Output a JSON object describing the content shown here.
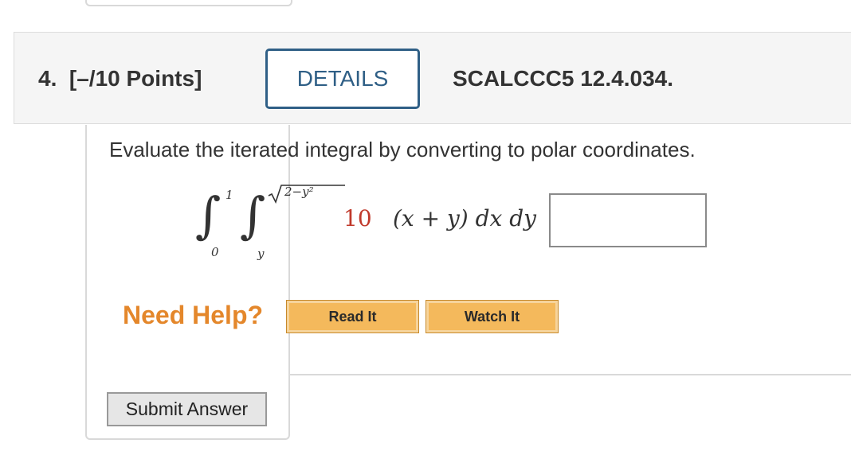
{
  "question": {
    "label": "4.  [–/10 Points]",
    "details_label": "DETAILS",
    "reference": "SCALCCC5 12.4.034."
  },
  "problem": {
    "prompt": "Evaluate the iterated integral by converting to polar coordinates.",
    "outer_lower": "0",
    "outer_upper": "1",
    "inner_lower": "y",
    "inner_upper": "2−y²",
    "coefficient": "10",
    "integrand": "(x + y) dx dy  =",
    "answer_value": ""
  },
  "help": {
    "heading": "Need Help?",
    "read_label": "Read It",
    "watch_label": "Watch It"
  },
  "actions": {
    "submit_label": "Submit Answer"
  },
  "colors": {
    "details_border": "#2f5f86",
    "help_orange": "#e4872b",
    "help_button": "#f4b95c",
    "coefficient_red": "#c0392b"
  }
}
